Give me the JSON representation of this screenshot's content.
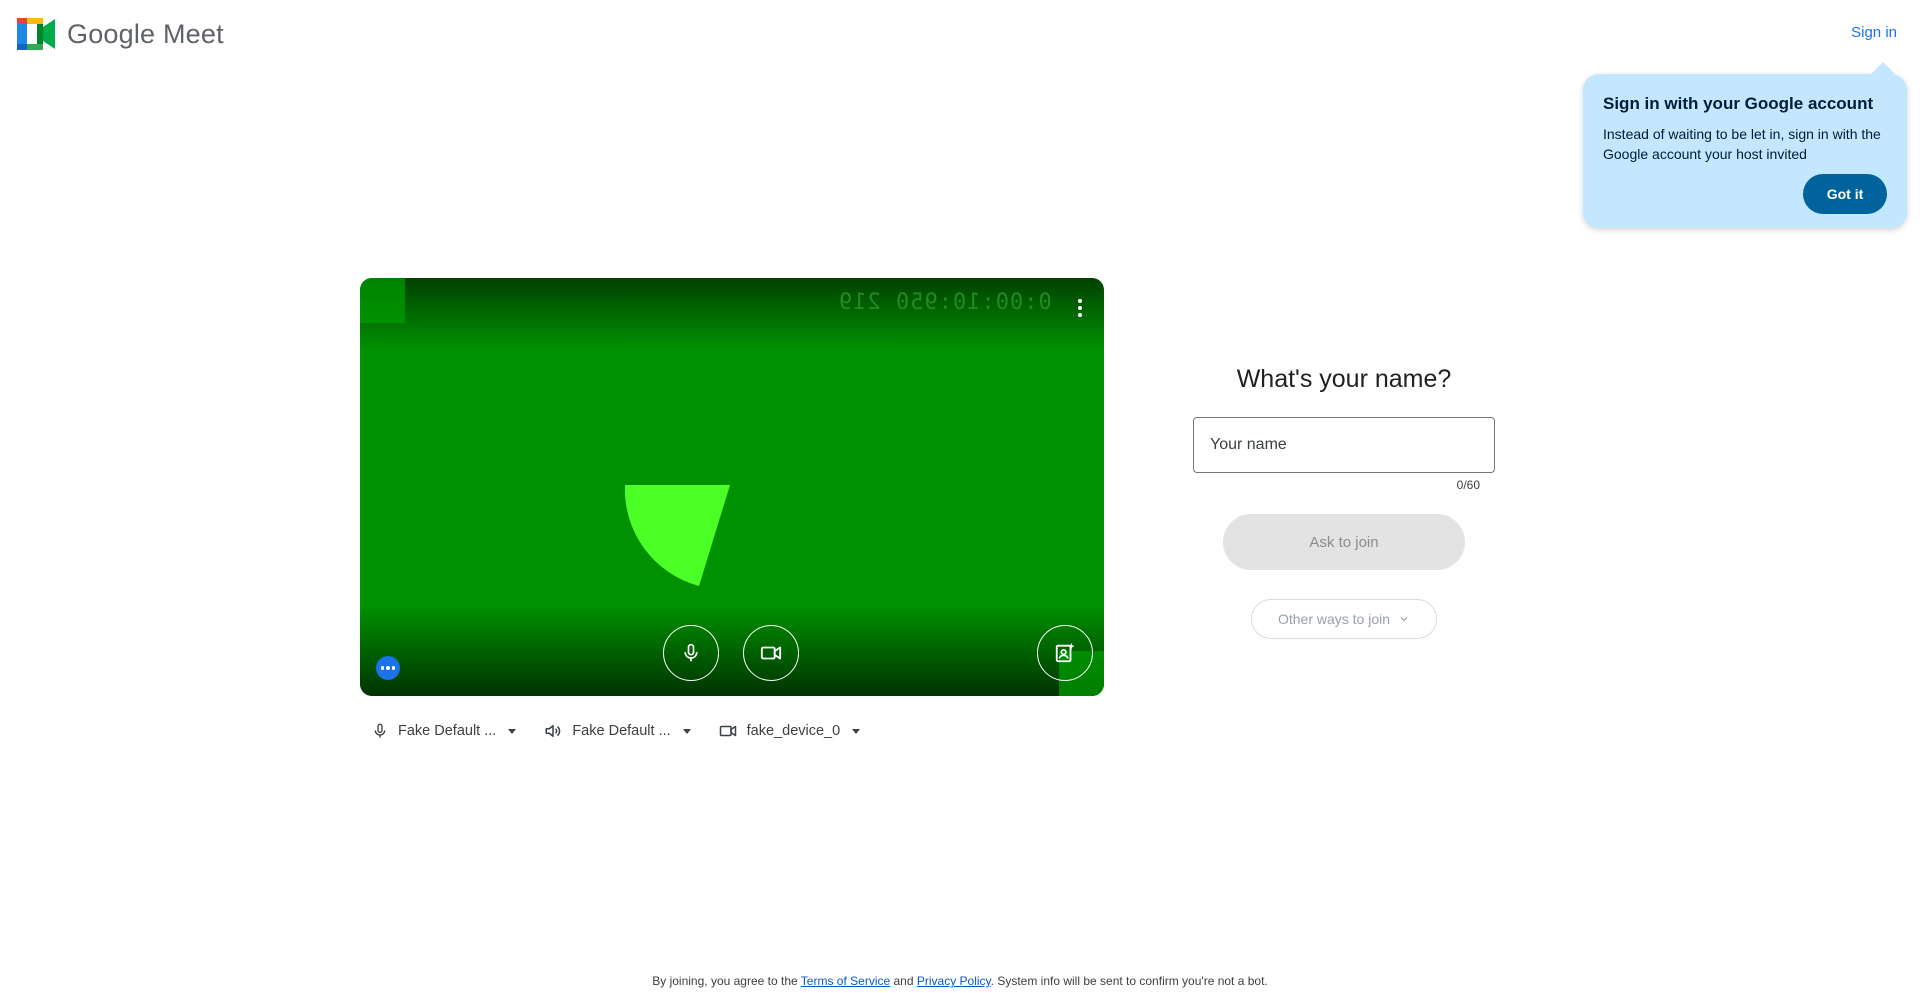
{
  "header": {
    "brand_name": "Google Meet",
    "signin_label": "Sign in",
    "logo_icon": "google-meet-logo"
  },
  "tooltip": {
    "title": "Sign in with your Google account",
    "body": "Instead of waiting to be let in, sign in with the Google account your host invited",
    "button_label": "Got it",
    "background_color": "#c2e7ff"
  },
  "preview": {
    "timestamp": "0:00:10:950 219",
    "background_color": "#009100",
    "shape_color": "#4cff26",
    "controls": {
      "mic_icon": "microphone-icon",
      "camera_icon": "videocam-icon",
      "effects_icon": "visual-effects-icon",
      "more_icon": "more-vert-icon",
      "more_options_icon": "more-horiz-icon"
    }
  },
  "devices": {
    "microphone": "Fake Default ...",
    "speaker": "Fake Default ...",
    "camera": "fake_device_0"
  },
  "join": {
    "title": "What's your name?",
    "name_placeholder": "Your name",
    "name_value": "",
    "char_count": "0/60",
    "ask_label": "Ask to join",
    "other_label": "Other ways to join"
  },
  "footer": {
    "prefix": "By joining, you agree to the ",
    "terms": "Terms of Service",
    "and": " and ",
    "privacy": "Privacy Policy",
    "suffix": ". System info will be sent to confirm you're not a bot."
  }
}
